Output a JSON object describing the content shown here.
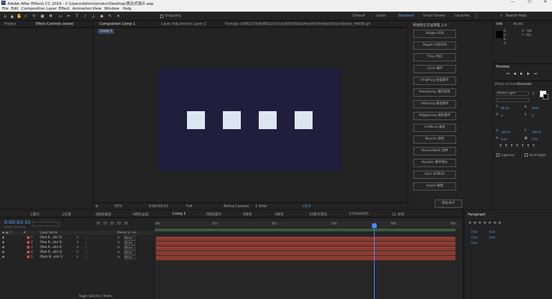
{
  "window": {
    "title": "Adobe After Effects CC 2019 - C:\\Users\\Administrator\\Desktop\\表达式演示.aep",
    "min": "—",
    "max": "☐",
    "close": "✕"
  },
  "menu": [
    "File",
    "Edit",
    "Composition",
    "Layer",
    "Effect",
    "Animation",
    "View",
    "Window",
    "Help"
  ],
  "toolbar": {
    "snapping": "Snapping",
    "workspaces": [
      "Default",
      "Learn",
      "Standard",
      "Small Screen",
      "Libraries"
    ],
    "search_placeholder": "Search Help"
  },
  "left_panel": {
    "tabs": [
      "Project",
      "Effect Controls (none)"
    ]
  },
  "comp_panel": {
    "tabs": [
      "Composition Comp 1",
      "Layer Adjustment Layer 2",
      "Footage c9082214d8d682251fcdc5b5d25be34ea0034ed9af2b02ce6ee0a_fw658.gif"
    ],
    "sub_tab": "Comp 1",
    "footer": {
      "zoom": "50%",
      "timecode": "0:00:03:10",
      "resolution": "Full",
      "view": "Active Camera",
      "views": "1 View",
      "exposure": "+0.0"
    },
    "bg_color": "#211d3d"
  },
  "expr_panel": {
    "title": "常用表达式运算集 2.0",
    "buttons": [
      "Wiggle 抖动",
      "Wiggle 分别抖动",
      "Time 时间",
      "Cycle 循环",
      "PingPong 往复循环",
      "RotateLoop 循环旋转",
      "PathLoop 路径循环",
      "WiggleLoop 随机循环",
      "CatMove 缓动",
      "Bounce 弹性",
      "BounceBack 回弹",
      "Number 数字增长",
      "Xto2 3D转2D",
      "target 跟随"
    ],
    "help": "帮助/关于"
  },
  "info_panel": {
    "tabs": [
      "Info",
      "Audio"
    ],
    "r": "R :",
    "g": "G :",
    "b": "B :",
    "a": "A :",
    "x": "X : 748",
    "y": "Y : 932"
  },
  "preview_panel": {
    "title": "Preview"
  },
  "character_panel": {
    "tabs": [
      "Effects & Presets",
      "Character"
    ],
    "font": "Wilkie Light",
    "size": "60 px",
    "leading": "Auto",
    "kerning": "0",
    "tracking": "0",
    "scale_v": "100 %",
    "scale_h": "100 %",
    "baseline": "0 px",
    "tsume": "0 %",
    "ligatures": "Ligatures",
    "hindi": "Hindi Digits"
  },
  "paragraph_panel": {
    "title": "Paragraph",
    "v1": "0 px",
    "v2": "0 px",
    "v3": "0 px",
    "v4": "0 px",
    "v5": "0 px"
  },
  "timeline": {
    "tabs": [
      "1弹引",
      "2位移",
      "3旋转缩放",
      "4随机运动",
      "Comp 1",
      "7随机循环",
      "8弹性",
      "9弹性",
      "10数字增长",
      "11StAdd3D",
      "12 目标"
    ],
    "timecode": "0:00:03:10",
    "fps": "00085 (25.00 fps)",
    "columns": {
      "num": "#",
      "name": "Layer Name",
      "parent": "Parent & Link"
    },
    "layers": [
      {
        "num": "1",
        "name": "[Pale R...olid 3]",
        "parent": "None"
      },
      {
        "num": "2",
        "name": "[Pale R...olid 3]",
        "parent": "None"
      },
      {
        "num": "3",
        "name": "[Pale R...olid 3]",
        "parent": "None"
      },
      {
        "num": "4",
        "name": "[Pale R...olid 3]",
        "parent": "None"
      },
      {
        "num": "5",
        "name": "[Dark B...olid 1]",
        "parent": "None"
      }
    ],
    "ruler": [
      "00s",
      "01s",
      "02s",
      "03s",
      "04s",
      "05s"
    ],
    "playhead_fraction": 0.727,
    "footer": "Toggle Switches / Modes"
  }
}
